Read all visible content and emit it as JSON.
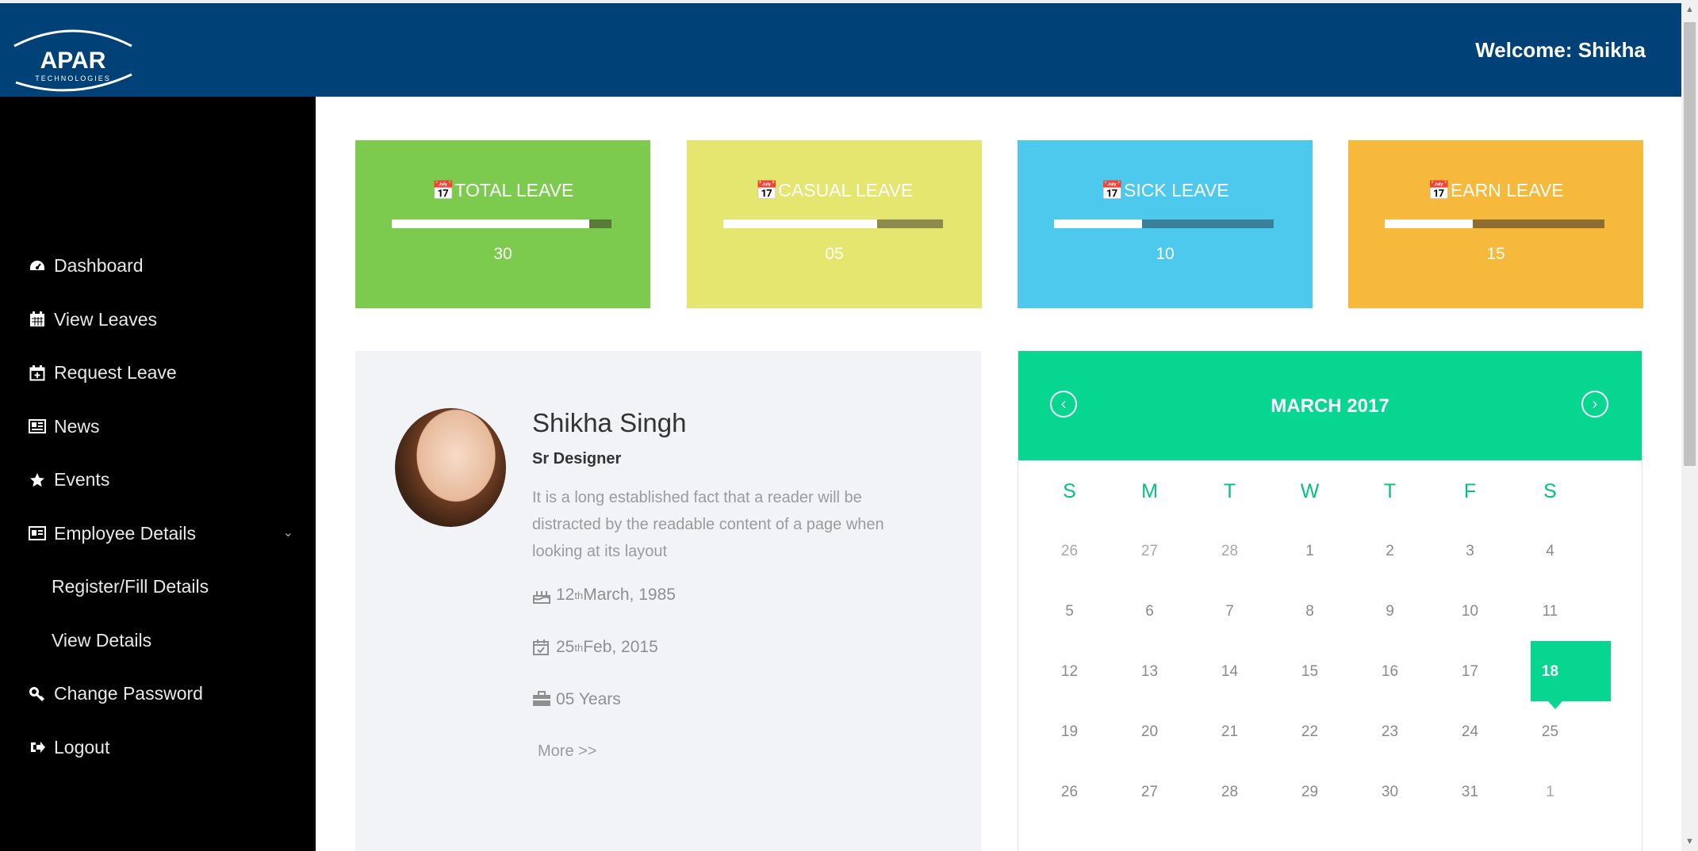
{
  "header": {
    "logo_text": "APAR",
    "logo_subtext": "TECHNOLOGIES",
    "welcome": "Welcome: Shikha",
    "bg_color": "#004277"
  },
  "sidebar": {
    "items": [
      {
        "label": "Dashboard",
        "icon": "dashboard-icon"
      },
      {
        "label": "View Leaves",
        "icon": "calendar-icon"
      },
      {
        "label": "Request Leave",
        "icon": "calendar-plus-icon"
      },
      {
        "label": "News",
        "icon": "newspaper-icon"
      },
      {
        "label": "Events",
        "icon": "star-icon"
      },
      {
        "label": "Employee Details",
        "icon": "id-card-icon"
      },
      {
        "label": "Register/Fill Details"
      },
      {
        "label": "View Details"
      },
      {
        "label": "Change Password",
        "icon": "key-icon"
      },
      {
        "label": "Logout",
        "icon": "logout-icon"
      }
    ]
  },
  "leave_cards": [
    {
      "title": "TOTAL LEAVE",
      "value": "30",
      "progress": 0.9,
      "color": "#7ccb4f",
      "track_color": "#5a7a3a"
    },
    {
      "title": "CASUAL LEAVE",
      "value": "05",
      "progress": 0.7,
      "color": "#e5e670",
      "track_color": "#8c8a4e"
    },
    {
      "title": "SICK LEAVE",
      "value": "10",
      "progress": 0.4,
      "color": "#4ec9ee",
      "track_color": "#3a8098"
    },
    {
      "title": "EARN LEAVE",
      "value": "15",
      "progress": 0.4,
      "color": "#f7b93b",
      "track_color": "#8f6d32"
    }
  ],
  "profile": {
    "name": "Shikha Singh",
    "role": "Sr Designer",
    "description": "It is a long established fact that a reader will be distracted by the readable content of a page when looking at its layout",
    "dob_day": "12",
    "dob_suffix": "th",
    "dob_rest": " March, 1985",
    "join_day": "25",
    "join_suffix": "th",
    "join_rest": " Feb, 2015",
    "experience": "05 Years",
    "more": "More >>"
  },
  "calendar": {
    "title": "MARCH 2017",
    "prev": "‹",
    "next": "›",
    "weekdays": [
      "S",
      "M",
      "T",
      "W",
      "T",
      "F",
      "S"
    ],
    "weeks": [
      [
        "26",
        "27",
        "28",
        "1",
        "2",
        "3",
        "4"
      ],
      [
        "5",
        "6",
        "7",
        "8",
        "9",
        "10",
        "11"
      ],
      [
        "12",
        "13",
        "14",
        "15",
        "16",
        "17",
        "18"
      ],
      [
        "19",
        "20",
        "21",
        "22",
        "23",
        "24",
        "25"
      ],
      [
        "26",
        "27",
        "28",
        "29",
        "30",
        "31",
        "1"
      ]
    ],
    "today": "18",
    "accent": "#06d690"
  }
}
